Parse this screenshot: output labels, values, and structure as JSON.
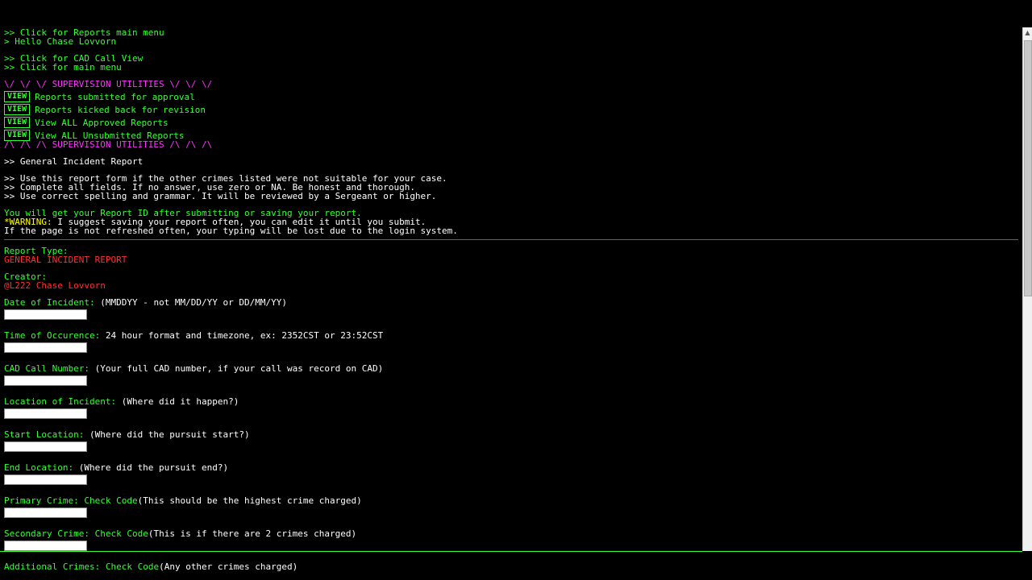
{
  "nav": {
    "reports_main_menu": ">> Click for Reports main menu",
    "hello": "> Hello Chase Lovvorn",
    "cad_call_view": ">> Click for CAD Call View",
    "main_menu": ">> Click for main menu"
  },
  "supervision": {
    "header_top": "\\/ \\/ \\/ SUPERVISION UTILITIES \\/ \\/ \\/",
    "view_label": "VIEW",
    "items": [
      "Reports submitted for approval",
      "Reports kicked back for revision",
      "View ALL Approved Reports",
      "View ALL Unsubmitted Reports"
    ],
    "header_bottom": "/\\ /\\ /\\ SUPERVISION UTILITIES /\\ /\\ /\\"
  },
  "report_title": ">> General Incident Report",
  "instructions": [
    ">> Use this report form if the other crimes listed were not suitable for your case.",
    ">> Complete all fields. If no answer, use zero or NA. Be honest and thorough.",
    ">> Use correct spelling and grammar. It will be reviewed by a Sergeant or higher."
  ],
  "notice": {
    "report_id": "You will get your Report ID after submitting or saving your report.",
    "warning_prefix": "*WARNING:",
    "warning_text": " I suggest saving your report often, you can edit it until you submit.",
    "refresh_text": "If the page is not refreshed often, your typing will be lost due to the login system."
  },
  "meta": {
    "report_type_label": "Report Type:",
    "report_type_value": "GENERAL INCIDENT REPORT",
    "creator_label": "Creator:",
    "creator_value": "@L222 Chase Lovvorn"
  },
  "fields": [
    {
      "label": "Date of Incident:",
      "link": "",
      "hint": " (MMDDYY - not MM/DD/YY or DD/MM/YY)"
    },
    {
      "label": "Time of Occurence:",
      "link": "",
      "hint": " 24 hour format and timezone, ex: 2352CST or 23:52CST"
    },
    {
      "label": "CAD Call Number:",
      "link": "",
      "hint": " (Your full CAD number, if your call was record on CAD)"
    },
    {
      "label": "Location of Incident:",
      "link": "",
      "hint": " (Where did it happen?)"
    },
    {
      "label": "Start Location:",
      "link": "",
      "hint": " (Where did the pursuit start?)"
    },
    {
      "label": "End Location:",
      "link": "",
      "hint": " (Where did the pursuit end?)"
    },
    {
      "label": "Primary Crime:",
      "link": " Check Code",
      "hint": "(This should be the highest crime charged)"
    },
    {
      "label": "Secondary Crime:",
      "link": " Check Code",
      "hint": "(This is if there are 2 crimes charged)"
    },
    {
      "label": "Additional Crimes:",
      "link": " Check Code",
      "hint": "(Any other crimes charged)"
    }
  ],
  "colors": {
    "accent_green": "#33ff33",
    "magenta": "#ff33ff",
    "red": "#ff3030",
    "yellow": "#ffff00",
    "background": "#000000"
  }
}
